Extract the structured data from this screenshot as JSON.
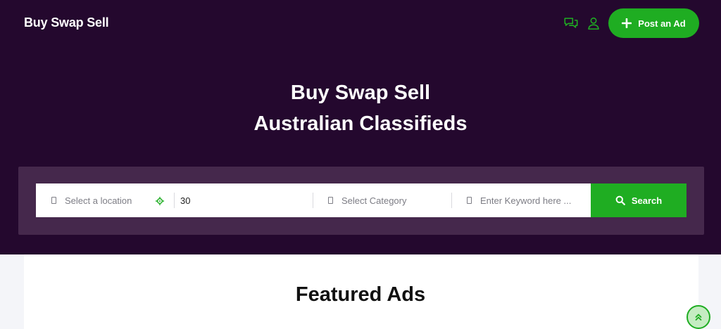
{
  "header": {
    "logo_text": "Buy Swap Sell",
    "chat_icon": "chat-bubbles-icon",
    "user_icon": "user-icon",
    "post_ad_label": "Post an Ad",
    "post_ad_icon": "plus-icon"
  },
  "hero": {
    "title_line1": "Buy Swap Sell",
    "title_line2": "Australian Classifieds"
  },
  "search": {
    "location_placeholder": "Select a location",
    "locate_icon": "crosshair-icon",
    "radius_value": "30",
    "category_placeholder": "Select Category",
    "keyword_placeholder": "Enter Keyword here ...",
    "button_label": "Search",
    "button_icon": "search-icon"
  },
  "featured": {
    "title": "Featured Ads"
  },
  "scroll_top_icon": "double-chevron-up-icon",
  "colors": {
    "hero_background": "#24082e",
    "search_panel": "#45284c",
    "accent_green": "#1fad22",
    "page_background": "#f4f5f9"
  }
}
